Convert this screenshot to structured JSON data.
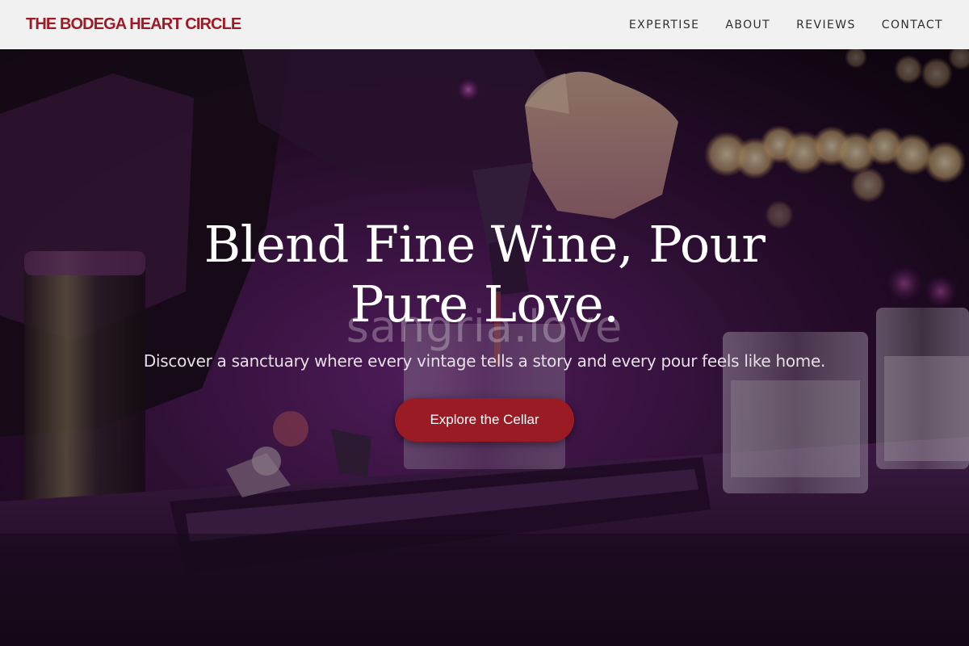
{
  "nav": {
    "brand": "THE BODEGA HEART CIRCLE",
    "links": [
      {
        "label": "EXPERTISE"
      },
      {
        "label": "ABOUT"
      },
      {
        "label": "REVIEWS"
      },
      {
        "label": "CONTACT"
      }
    ]
  },
  "hero": {
    "title_line1": "Blend Fine Wine, Pour",
    "title_line2": "Pure Love.",
    "watermark": "sangria.love",
    "subtitle": "Discover a sanctuary where every vintage tells a story and every pour feels like home.",
    "cta_label": "Explore the Cellar",
    "background_photo": "bartender pouring drink at bar with glasses, purple lighting and bokeh lights"
  },
  "colors": {
    "brand": "#9c1b26",
    "nav_bg": "#f1f1f1",
    "nav_text": "#2f2f2f",
    "cta_bg": "#9a1b24",
    "title_text": "#ffffff",
    "hero_tint": "#6a1d7a"
  }
}
